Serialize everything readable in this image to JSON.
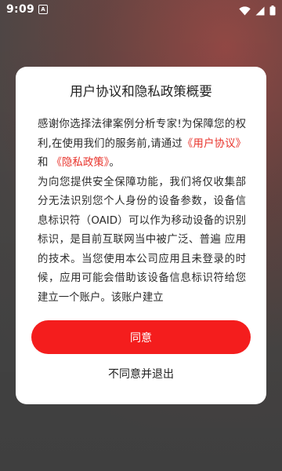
{
  "status_bar": {
    "time": "9:09",
    "notification_icon": "A",
    "icons": [
      "wifi-icon",
      "signal-icon",
      "battery-icon"
    ]
  },
  "dialog": {
    "title": "用户协议和隐私政策概要",
    "intro_before": "感谢你选择法律案例分析专家!为保障您的权利,在使用我们的服务前,请通过",
    "user_agreement_link": "《用户协议》",
    "and": "和",
    "privacy_policy_link": "《隐私政策》",
    "intro_after": "。",
    "paragraph2": "为向您提供安全保障功能，我们将仅收集部分无法识别您个人身份的设备参数，设备信息标识符（OAID）可以作为移动设备的识别标识，是目前互联网当中被广泛、普遍 应用的技术。当您使用本公司应用且未登录的时候，应用可能会借助该设备信息标识符给您建立一个账户。该账户建立",
    "agree_button": "同意",
    "disagree_button": "不同意并退出"
  },
  "colors": {
    "accent": "#f41d1d",
    "link": "#e8322a"
  }
}
